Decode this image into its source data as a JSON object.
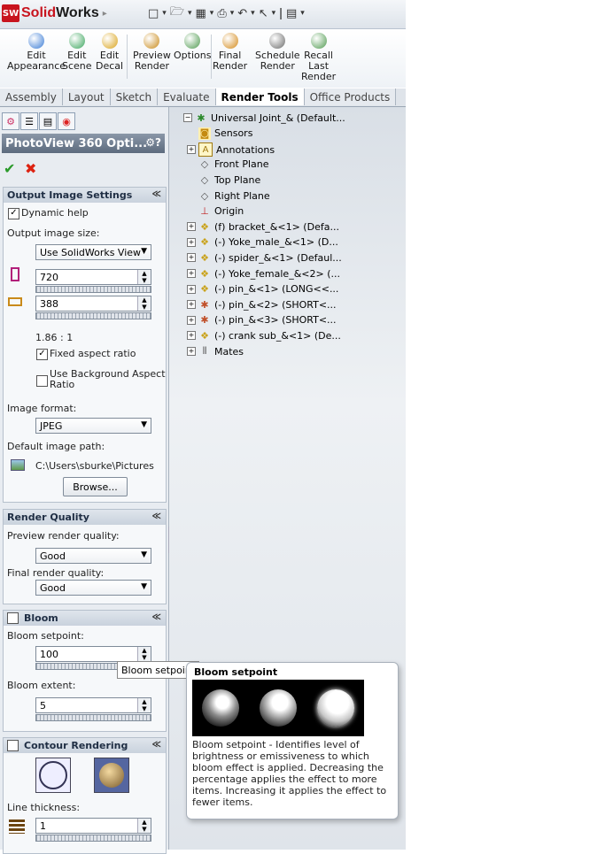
{
  "app": {
    "brand_solid": "Solid",
    "brand_works": "Works",
    "logo_letters": "SW"
  },
  "quick_access": [
    "□",
    "▾",
    "🗁",
    "▾",
    "▦",
    "▾",
    "⎙",
    "▾",
    "↶",
    "▾",
    "↖",
    "▾",
    "ǀ",
    "▤",
    "▾"
  ],
  "commands": [
    {
      "label": "Edit\nAppearance",
      "icon": "edit-appearance-icon",
      "color": "#3a7bd5"
    },
    {
      "label": "Edit\nScene",
      "icon": "edit-scene-icon",
      "color": "#3ba55c"
    },
    {
      "label": "Edit\nDecal",
      "icon": "edit-decal-icon",
      "color": "#d9a31a"
    },
    {
      "label": "Preview\nRender",
      "icon": "preview-render-icon",
      "color": "#c98a1a"
    },
    {
      "label": "Options",
      "icon": "options-icon",
      "color": "#4f9a4f"
    },
    {
      "label": "Final\nRender",
      "icon": "final-render-icon",
      "color": "#d48a1a"
    },
    {
      "label": "Schedule\nRender",
      "icon": "schedule-render-icon",
      "color": "#6a6a6a"
    },
    {
      "label": "Recall\nLast\nRender",
      "icon": "recall-last-render-icon",
      "color": "#4f9a4f"
    }
  ],
  "tabs": [
    "Assembly",
    "Layout",
    "Sketch",
    "Evaluate",
    "Render Tools",
    "Office Products"
  ],
  "active_tab": "Render Tools",
  "pm": {
    "title": "PhotoView 360 Opti...",
    "help": "?",
    "output": {
      "header": "Output Image Settings",
      "dynamic_help": "Dynamic help",
      "output_size_label": "Output image size:",
      "size_option": "Use SolidWorks View",
      "width": "720",
      "height": "388",
      "ratio": "1.86 : 1",
      "fixed_aspect": "Fixed aspect ratio",
      "bg_aspect": "Use Background Aspect\nRatio",
      "format_label": "Image format:",
      "format": "JPEG",
      "path_label": "Default image path:",
      "path": "C:\\Users\\sburke\\Pictures",
      "browse": "Browse..."
    },
    "quality": {
      "header": "Render Quality",
      "preview_label": "Preview render quality:",
      "preview": "Good",
      "final_label": "Final render quality:",
      "final": "Good"
    },
    "bloom": {
      "header": "Bloom",
      "setpoint_label": "Bloom setpoint:",
      "setpoint": "100",
      "extent_label": "Bloom extent:",
      "extent": "5"
    },
    "contour": {
      "header": "Contour Rendering",
      "thickness_label": "Line thickness:",
      "thickness": "1"
    }
  },
  "tree": [
    {
      "label": "Universal Joint_& (Default...",
      "icon": "assembly-icon",
      "indent": 0,
      "expander": "−"
    },
    {
      "label": "Sensors",
      "icon": "sensors-icon",
      "indent": 1,
      "expander": ""
    },
    {
      "label": "Annotations",
      "icon": "annotations-icon",
      "indent": 1,
      "expander": "+"
    },
    {
      "label": "Front Plane",
      "icon": "plane-icon",
      "indent": 1,
      "expander": ""
    },
    {
      "label": "Top Plane",
      "icon": "plane-icon",
      "indent": 1,
      "expander": ""
    },
    {
      "label": "Right Plane",
      "icon": "plane-icon",
      "indent": 1,
      "expander": ""
    },
    {
      "label": "Origin",
      "icon": "origin-icon",
      "indent": 1,
      "expander": ""
    },
    {
      "label": "(f) bracket_&<1> (Defa...",
      "icon": "part-icon",
      "indent": 1,
      "expander": "+"
    },
    {
      "label": "(-) Yoke_male_&<1> (D...",
      "icon": "part-icon",
      "indent": 1,
      "expander": "+"
    },
    {
      "label": "(-) spider_&<1> (Defaul...",
      "icon": "part-icon",
      "indent": 1,
      "expander": "+"
    },
    {
      "label": "(-) Yoke_female_&<2> (...",
      "icon": "part-icon",
      "indent": 1,
      "expander": "+"
    },
    {
      "label": "(-) pin_&<1> (LONG<<...",
      "icon": "part-icon",
      "indent": 1,
      "expander": "+"
    },
    {
      "label": "(-) pin_&<2> (SHORT<...",
      "icon": "subassembly-icon",
      "indent": 1,
      "expander": "+"
    },
    {
      "label": "(-) pin_&<3> (SHORT<...",
      "icon": "subassembly-icon",
      "indent": 1,
      "expander": "+"
    },
    {
      "label": "(-) crank sub_&<1> (De...",
      "icon": "part-icon",
      "indent": 1,
      "expander": "+"
    },
    {
      "label": "Mates",
      "icon": "mates-icon",
      "indent": 1,
      "expander": "+"
    }
  ],
  "tooltip": {
    "small": "Bloom setpoint",
    "title": "Bloom setpoint",
    "description": "Bloom setpoint - Identifies level of brightness or emissiveness to which bloom effect is applied. Decreasing the percentage applies the effect to more items. Increasing it applies the effect to fewer items."
  }
}
